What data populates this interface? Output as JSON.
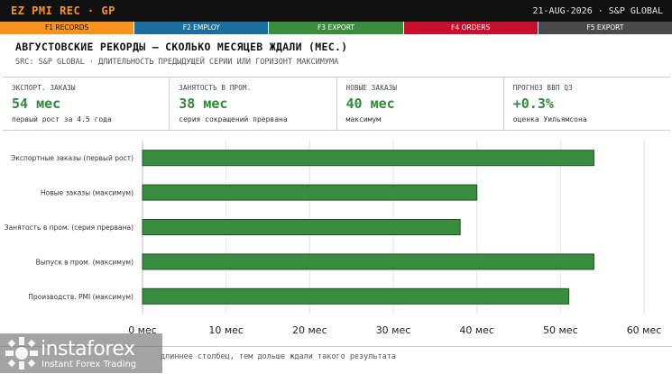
{
  "titlebar": {
    "app": "EZ PMI REC · GP",
    "meta": "21-AUG-2026 · S&P GLOBAL"
  },
  "tabs": [
    {
      "label": "F1 RECORDS",
      "color": "#f7931e",
      "text_color": "#111"
    },
    {
      "label": "F2 EMPLOY",
      "color": "#1b6f9e",
      "text_color": "#fff"
    },
    {
      "label": "F3 EXPORT",
      "color": "#3a8c3f",
      "text_color": "#fff"
    },
    {
      "label": "F4 ORDERS",
      "color": "#c8102e",
      "text_color": "#fff"
    },
    {
      "label": "F5 EXPORT",
      "color": "#4a4a4a",
      "text_color": "#fff"
    }
  ],
  "heading": {
    "title": "АВГУСТОВСКИЕ РЕКОРДЫ — СКОЛЬКО МЕСЯЦЕВ ЖДАЛИ (МЕС.)",
    "subtitle": "SRC: S&P GLOBAL · ДЛИТЕЛЬНОСТЬ ПРЕДЫДУЩЕЙ СЕРИИ ИЛИ ГОРИЗОНТ МАКСИМУМА"
  },
  "kpis": [
    {
      "label": "ЭКСПОРТ. ЗАКАЗЫ",
      "value": "54 мес",
      "note": "первый рост за 4.5 года"
    },
    {
      "label": "ЗАНЯТОСТЬ В ПРОМ.",
      "value": "38 мес",
      "note": "серия сокращений прервана"
    },
    {
      "label": "НОВЫЕ ЗАКАЗЫ",
      "value": "40 мес",
      "note": "максимум"
    },
    {
      "label": "ПРОГНОЗ ВВП Q3",
      "value": "+0.3%",
      "note": "оценка Уильямсона"
    }
  ],
  "colors": {
    "accent_green": "#2e8b3a",
    "bar_fill": "#3a8c3f",
    "bar_stroke": "#1f4f23",
    "grid": "#e3e3e3"
  },
  "chart_data": {
    "type": "bar",
    "orientation": "horizontal",
    "categories": [
      "Экспортные заказы (первый рост)",
      "Новые заказы (максимум)",
      "Занятость в пром. (серия прервана)",
      "Выпуск в пром. (максимум)",
      "Производств. PMI (максимум)"
    ],
    "values": [
      54,
      40,
      38,
      54,
      51
    ],
    "xlim": [
      0,
      60
    ],
    "xticks": [
      0,
      10,
      20,
      30,
      40,
      50,
      60
    ],
    "tick_unit": " мес",
    "grid": true,
    "legend": "none"
  },
  "footer": {
    "note": "длиннее столбец, тем дольше ждали такого результата"
  },
  "watermark": {
    "name": "instaforex",
    "tagline": "Instant Forex Trading"
  }
}
